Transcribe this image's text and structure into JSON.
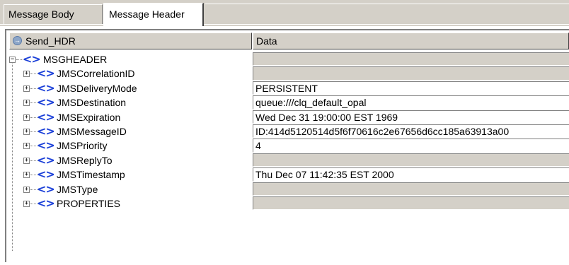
{
  "tabs": [
    {
      "label": "Message Body",
      "active": false
    },
    {
      "label": "Message Header",
      "active": true
    }
  ],
  "columns": {
    "name_header": "Send_HDR",
    "data_header": "Data"
  },
  "tree": {
    "root": {
      "label": "MSGHEADER",
      "value": ""
    },
    "children": [
      {
        "label": "JMSCorrelationID",
        "value": ""
      },
      {
        "label": "JMSDeliveryMode",
        "value": "PERSISTENT"
      },
      {
        "label": "JMSDestination",
        "value": "queue:///clq_default_opal"
      },
      {
        "label": "JMSExpiration",
        "value": "Wed Dec 31 19:00:00 EST 1969"
      },
      {
        "label": "JMSMessageID",
        "value": "ID:414d5120514d5f6f70616c2e67656d6cc185a63913a00"
      },
      {
        "label": "JMSPriority",
        "value": "4"
      },
      {
        "label": "JMSReplyTo",
        "value": ""
      },
      {
        "label": "JMSTimestamp",
        "value": "Thu Dec 07 11:42:35 EST 2000"
      },
      {
        "label": "JMSType",
        "value": ""
      },
      {
        "label": "PROPERTIES",
        "value": ""
      }
    ]
  },
  "icons": {
    "node": "xml-tag-icon",
    "expand": "plus-box-icon",
    "collapse": "minus-box-icon",
    "header": "circle-arrow-icon"
  },
  "colors": {
    "chrome": "#d4d0c8",
    "tag_icon": "#1a3fd8"
  }
}
